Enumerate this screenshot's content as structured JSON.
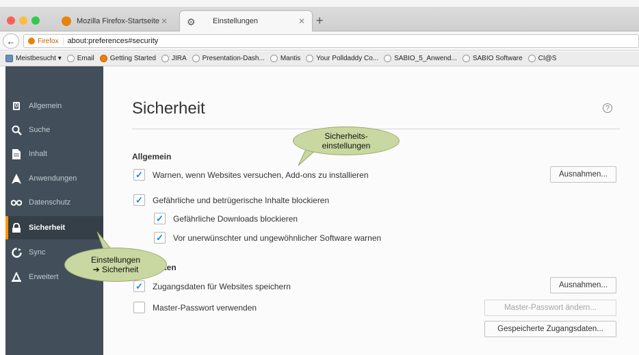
{
  "browser": {
    "tabs": [
      {
        "label": "Mozilla Firefox-Startseite",
        "active": false
      },
      {
        "label": "Einstellungen",
        "active": true
      }
    ],
    "url": {
      "identity": "Firefox",
      "value": "about:preferences#security"
    },
    "bookmarks": [
      "Meistbesucht ▾",
      "Email",
      "Getting Started",
      "JIRA",
      "Presentation-Dash...",
      "Mantis",
      "Your Polldaddy Co...",
      "SABIO_5_Anwend...",
      "SABIO Software",
      "CI@S"
    ]
  },
  "sidebar": {
    "items": [
      {
        "label": "Allgemein",
        "icon": "general-icon"
      },
      {
        "label": "Suche",
        "icon": "search-icon"
      },
      {
        "label": "Inhalt",
        "icon": "content-icon"
      },
      {
        "label": "Anwendungen",
        "icon": "applications-icon"
      },
      {
        "label": "Datenschutz",
        "icon": "privacy-mask-icon"
      },
      {
        "label": "Sicherheit",
        "icon": "lock-icon",
        "active": true
      },
      {
        "label": "Sync",
        "icon": "sync-icon"
      },
      {
        "label": "Erweitert",
        "icon": "advanced-icon"
      }
    ]
  },
  "main": {
    "title": "Sicherheit",
    "general": {
      "heading": "Allgemein",
      "warn_addons": "Warnen, wenn Websites versuchen, Add-ons zu installieren",
      "exceptions": "Ausnahmen...",
      "block_dangerous": "Gefährliche und betrügerische Inhalte blockieren",
      "block_downloads": "Gefährliche Downloads blockieren",
      "warn_software": "Vor unerwünschter und ungewöhnlicher Software warnen"
    },
    "logins": {
      "heading_partial": "aten",
      "save_logins": "Zugangsdaten für Websites speichern",
      "exceptions": "Ausnahmen...",
      "master_password": "Master-Passwort verwenden",
      "change_master": "Master-Passwort ändern...",
      "saved_logins": "Gespeicherte Zugangsdaten..."
    }
  },
  "annotations": {
    "security_settings_line1": "Sicherheits-",
    "security_settings_line2": "einstellungen",
    "settings_nav_line1": "Einstellungen",
    "settings_nav_line2": "➔ Sicherheit"
  },
  "colors": {
    "accent": "#ff9500",
    "sidebar_bg": "#424f5a",
    "check": "#0a84ff",
    "callout": "#c9d7a1"
  }
}
